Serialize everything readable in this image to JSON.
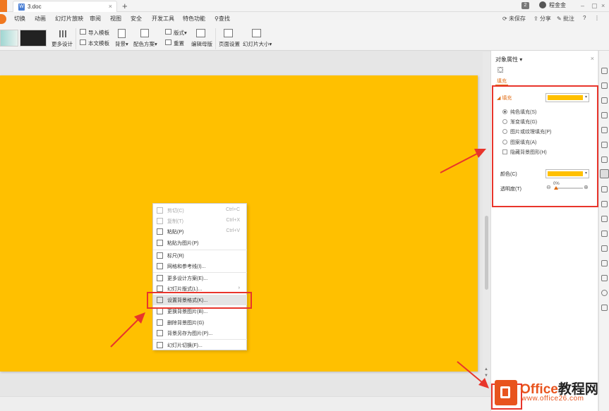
{
  "titlebar": {
    "tab_icon": "W",
    "tab_title": "3.doc",
    "new_tab": "+",
    "badge": "2",
    "username": "程金金",
    "minimize": "–",
    "restore": "▢",
    "close": "×"
  },
  "menu": {
    "items": [
      "切换",
      "动画",
      "幻灯片放映",
      "审阅",
      "视图",
      "安全",
      "开发工具",
      "特色功能",
      "查找"
    ],
    "right": {
      "unsaved": "未保存",
      "share": "分享",
      "comment": "批注",
      "help": "?"
    }
  },
  "ribbon": {
    "more_design": "更多设计",
    "import_template": "导入模板",
    "text_template": "本文模板",
    "background": "背景",
    "color_scheme": "配色方案",
    "layout": "版式",
    "reset": "重置",
    "edit_master": "编辑母版",
    "page_setup": "页面设置",
    "slide_size": "幻灯片大小"
  },
  "context_menu": {
    "items": [
      {
        "label": "剪切(C)",
        "shortcut": "Ctrl+C",
        "disabled": true
      },
      {
        "label": "复制(T)",
        "shortcut": "Ctrl+X",
        "disabled": true
      },
      {
        "label": "粘贴(P)",
        "shortcut": "Ctrl+V",
        "disabled": false
      },
      {
        "label": "粘贴为图片(P)",
        "shortcut": "",
        "disabled": false
      },
      {
        "label": "标尺(R)",
        "shortcut": "",
        "disabled": false
      },
      {
        "label": "网格和参考线(I)...",
        "shortcut": "",
        "disabled": false
      },
      {
        "label": "更多设计方案(E)...",
        "shortcut": "",
        "disabled": false
      },
      {
        "label": "幻灯片版式(L)...",
        "shortcut": "›",
        "disabled": false
      },
      {
        "label": "设置背景格式(K)...",
        "shortcut": "",
        "disabled": false
      },
      {
        "label": "更换背景图片(B)...",
        "shortcut": "",
        "disabled": false
      },
      {
        "label": "删除背景图片(G)",
        "shortcut": "",
        "disabled": false
      },
      {
        "label": "背景另存为图片(P)...",
        "shortcut": "",
        "disabled": false
      },
      {
        "label": "幻灯片切换(F)...",
        "shortcut": "",
        "disabled": false
      }
    ]
  },
  "panel": {
    "title": "对象属性",
    "title_caret": "▾",
    "close": "×",
    "tab_fill": "填充",
    "section_fill": "填充",
    "fill_options": [
      "纯色填充(S)",
      "渐变填充(G)",
      "图片或纹理填充(P)",
      "图案填充(A)"
    ],
    "selected_fill": 0,
    "hide_bg_graphics": "隐藏背景图形(H)",
    "color_label": "颜色(C)",
    "transparency_label": "透明度(T)",
    "transparency_value": "0%",
    "fill_color": "#FFC000"
  },
  "watermark": {
    "brand_latin": "Office",
    "brand_cn": "教程网",
    "url": "www.office26.com"
  },
  "colors": {
    "slide": "#FFC000",
    "accent": "#E06A10",
    "highlight_red": "#E8352B"
  }
}
